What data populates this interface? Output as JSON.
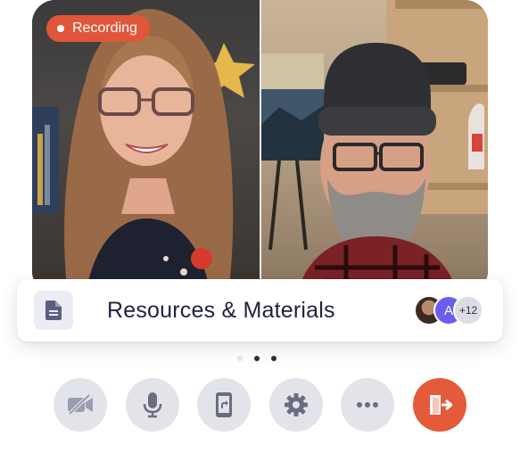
{
  "recording": {
    "label": "Recording",
    "color": "#e1563a"
  },
  "card": {
    "title": "Resources & Materials",
    "icon": "document-icon",
    "participants": [
      {
        "type": "photo"
      },
      {
        "type": "initial",
        "text": "A",
        "color": "#6a5df0"
      },
      {
        "type": "overflow",
        "text": "+12"
      }
    ]
  },
  "pager": {
    "count": 3,
    "active": 1
  },
  "controls": [
    {
      "name": "camera-off-button",
      "icon": "video-off-icon"
    },
    {
      "name": "microphone-button",
      "icon": "microphone-icon"
    },
    {
      "name": "share-screen-button",
      "icon": "share-screen-icon"
    },
    {
      "name": "settings-button",
      "icon": "gear-icon"
    },
    {
      "name": "more-options-button",
      "icon": "more-icon"
    },
    {
      "name": "leave-call-button",
      "icon": "exit-door-icon",
      "color": "#e45a3b"
    }
  ]
}
